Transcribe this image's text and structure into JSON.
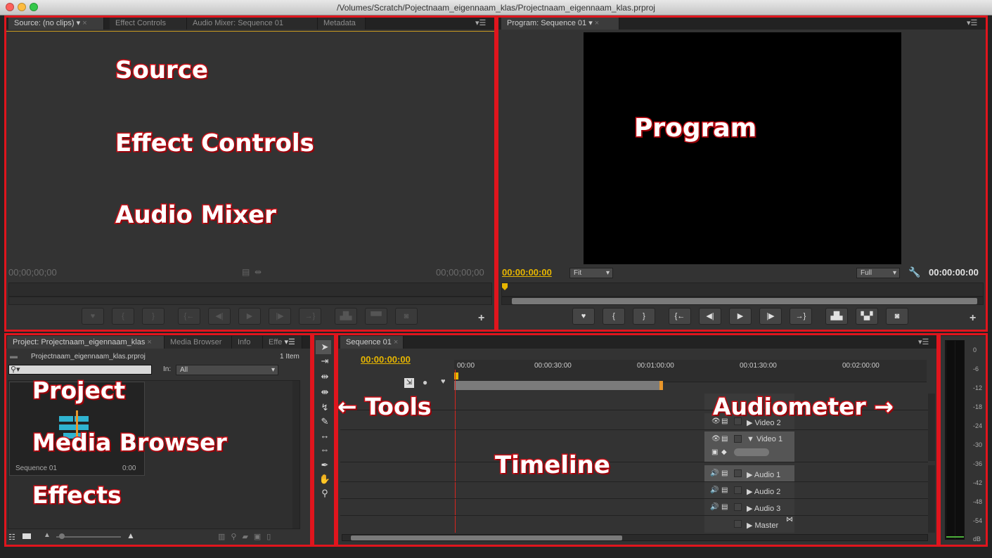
{
  "window": {
    "title": "/Volumes/Scratch/Pojectnaam_eigennaam_klas/Projectnaam_eigennaam_klas.prproj"
  },
  "colors": {
    "accent_timecode": "#e7b600",
    "annotation_red": "#e0151d",
    "playhead": "#e8962a"
  },
  "source_panel": {
    "tabs": [
      "Source: (no clips)",
      "Effect Controls",
      "Audio Mixer: Sequence 01",
      "Metadata"
    ],
    "timecode_left": "00;00;00;00",
    "timecode_right": "00;00;00;00"
  },
  "program_panel": {
    "tabs": [
      "Program: Sequence 01"
    ],
    "timecode_left": "00:00:00:00",
    "timecode_right": "00:00:00:00",
    "fit_dropdown": "Fit",
    "quality_dropdown": "Full"
  },
  "project_panel": {
    "tabs": [
      "Project: Projectnaam_eigennaam_klas",
      "Media Browser",
      "Info",
      "Effe"
    ],
    "project_file": "Projectnaam_eigennaam_klas.prproj",
    "item_count": "1 Item",
    "search_placeholder": "",
    "in_label": "In:",
    "in_value": "All",
    "clip": {
      "name": "Sequence 01",
      "duration": "0:00"
    }
  },
  "timeline": {
    "tab": "Sequence 01",
    "timecode": "00:00:00:00",
    "ruler": [
      "00:00",
      "00:00:30:00",
      "00:01:00:00",
      "00:01:30:00",
      "00:02:00:00"
    ],
    "tracks": [
      "Video 2",
      "Video 1",
      "Audio 1",
      "Audio 2",
      "Audio 3",
      "Master"
    ]
  },
  "audiometer": {
    "scale": [
      "0",
      "-6",
      "-12",
      "-18",
      "-24",
      "-30",
      "-36",
      "-42",
      "-48",
      "-54",
      "dB"
    ]
  },
  "annotations": {
    "source": "Source",
    "effect_controls": "Effect Controls",
    "audio_mixer": "Audio Mixer",
    "program": "Program",
    "project": "Project",
    "media_browser": "Media Browser",
    "effects": "Effects",
    "tools": "← Tools",
    "audiometer": "Audiometer →",
    "timeline": "Timeline"
  }
}
